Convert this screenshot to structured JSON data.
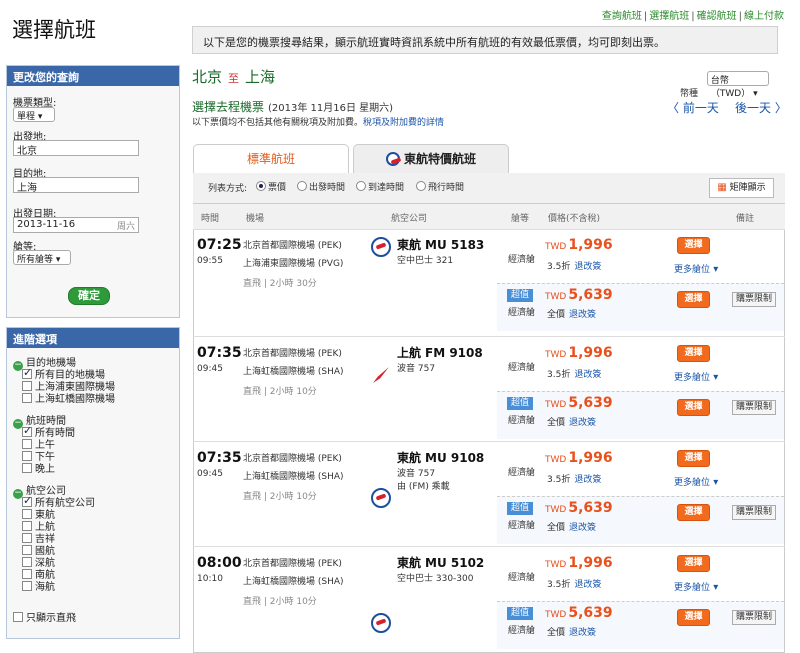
{
  "page": {
    "title": "選擇航班"
  },
  "steps": [
    "查詢航班",
    "選擇航班",
    "確認航班",
    "線上付款"
  ],
  "notice": "以下是您的機票搜尋結果，顯示航班實時資訊系統中所有航班的有效最低票價，均可即刻出票。",
  "search": {
    "header": "更改您的查詢",
    "ticket_type_label": "機票類型:",
    "ticket_type_value": "單程",
    "from_label": "出發地:",
    "from_value": "北京",
    "to_label": "目的地:",
    "to_value": "上海",
    "date_label": "出發日期:",
    "date_value": "2013-11-16",
    "date_weekday": "周六",
    "cabin_label": "艙等:",
    "cabin_value": "所有艙等",
    "confirm_label": "確定"
  },
  "filters": {
    "header": "進階選項",
    "groups": [
      {
        "title": "目的地機場",
        "items": [
          {
            "label": "所有目的地機場",
            "checked": true
          },
          {
            "label": "上海浦東國際機場",
            "checked": false
          },
          {
            "label": "上海虹橋國際機場",
            "checked": false
          }
        ]
      },
      {
        "title": "航班時間",
        "items": [
          {
            "label": "所有時間",
            "checked": true
          },
          {
            "label": "上午",
            "checked": false
          },
          {
            "label": "下午",
            "checked": false
          },
          {
            "label": "晚上",
            "checked": false
          }
        ]
      },
      {
        "title": "航空公司",
        "items": [
          {
            "label": "所有航空公司",
            "checked": true
          },
          {
            "label": "東航",
            "checked": false
          },
          {
            "label": "上航",
            "checked": false
          },
          {
            "label": "吉祥",
            "checked": false
          },
          {
            "label": "國航",
            "checked": false
          },
          {
            "label": "深航",
            "checked": false
          },
          {
            "label": "南航",
            "checked": false
          },
          {
            "label": "海航",
            "checked": false
          }
        ]
      }
    ],
    "nonstop_label": "只顯示直飛"
  },
  "route": {
    "from": "北京",
    "to_word": "至",
    "to": "上海"
  },
  "currency": {
    "label": "幣種",
    "value": "台幣（TWD）"
  },
  "section": {
    "title": "選擇去程機票",
    "date": "(2013年 11月16日 星期六)"
  },
  "note": {
    "text": "以下票價均不包括其他有關稅項及附加費。",
    "link": "稅項及附加費的詳情"
  },
  "daynav": {
    "prev": "〈 前一天",
    "next": "後一天 〉"
  },
  "tabs": [
    {
      "label": "標準航班"
    },
    {
      "label": "東航特價航班"
    }
  ],
  "sort": {
    "label": "列表方式:",
    "options": [
      {
        "label": "票價",
        "selected": true
      },
      {
        "label": "出發時間",
        "selected": false
      },
      {
        "label": "到達時間",
        "selected": false
      },
      {
        "label": "飛行時間",
        "selected": false
      }
    ],
    "matrix_label": "矩陣顯示"
  },
  "columns": {
    "time": "時間",
    "airport": "機場",
    "airline": "航空公司",
    "cabin": "艙等",
    "price": "價格(不含稅)",
    "remark": "備註"
  },
  "flights": [
    {
      "dep": "07:25",
      "arr": "09:55",
      "from_apt": "北京首都國際機場 (PEK)",
      "to_apt": "上海浦東國際機場 (PVG)",
      "duration": "直飛 | 2小時 30分",
      "airline": "東航",
      "flight_no": "MU 5183",
      "plane": "空中巴士 321",
      "operated": "",
      "logo": "mu",
      "fare1": {
        "cabin": "經濟艙",
        "currency": "TWD",
        "price": "1,996",
        "discount": "3.5折",
        "change": "退改簽",
        "book": "選擇",
        "more": "更多艙位"
      },
      "fare2": {
        "badge": "超值",
        "cabin": "經濟艙",
        "currency": "TWD",
        "price": "5,639",
        "discount": "全價",
        "change": "退改簽",
        "book": "選擇",
        "limit": "購票限制"
      }
    },
    {
      "dep": "07:35",
      "arr": "09:45",
      "from_apt": "北京首都國際機場 (PEK)",
      "to_apt": "上海虹橋國際機場 (SHA)",
      "duration": "直飛 | 2小時 10分",
      "airline": "上航",
      "flight_no": "FM 9108",
      "plane": "波音 757",
      "operated": "",
      "logo": "fm",
      "fare1": {
        "cabin": "經濟艙",
        "currency": "TWD",
        "price": "1,996",
        "discount": "3.5折",
        "change": "退改簽",
        "book": "選擇",
        "more": "更多艙位"
      },
      "fare2": {
        "badge": "超值",
        "cabin": "經濟艙",
        "currency": "TWD",
        "price": "5,639",
        "discount": "全價",
        "change": "退改簽",
        "book": "選擇",
        "limit": "購票限制"
      }
    },
    {
      "dep": "07:35",
      "arr": "09:45",
      "from_apt": "北京首都國際機場 (PEK)",
      "to_apt": "上海虹橋國際機場 (SHA)",
      "duration": "直飛 | 2小時 10分",
      "airline": "東航",
      "flight_no": "MU 9108",
      "plane": "波音 757",
      "operated": "由 (FM) 乘載",
      "logo": "mu",
      "fare1": {
        "cabin": "經濟艙",
        "currency": "TWD",
        "price": "1,996",
        "discount": "3.5折",
        "change": "退改簽",
        "book": "選擇",
        "more": "更多艙位"
      },
      "fare2": {
        "badge": "超值",
        "cabin": "經濟艙",
        "currency": "TWD",
        "price": "5,639",
        "discount": "全價",
        "change": "退改簽",
        "book": "選擇",
        "limit": "購票限制"
      }
    },
    {
      "dep": "08:00",
      "arr": "10:10",
      "from_apt": "北京首都國際機場 (PEK)",
      "to_apt": "上海虹橋國際機場 (SHA)",
      "duration": "直飛 | 2小時 10分",
      "airline": "東航",
      "flight_no": "MU 5102",
      "plane": "空中巴士 330-300",
      "operated": "",
      "logo": "mu",
      "fare1": {
        "cabin": "經濟艙",
        "currency": "TWD",
        "price": "1,996",
        "discount": "3.5折",
        "change": "退改簽",
        "book": "選擇",
        "more": "更多艙位"
      },
      "fare2": {
        "badge": "超值",
        "cabin": "經濟艙",
        "currency": "TWD",
        "price": "5,639",
        "discount": "全價",
        "change": "退改簽",
        "book": "選擇",
        "limit": "購票限制"
      }
    }
  ],
  "colors": {
    "accent": "#f26a1d",
    "brand_green": "#1a6a2a",
    "sidebar_header": "#3a67a8",
    "price": "#e8501c"
  }
}
